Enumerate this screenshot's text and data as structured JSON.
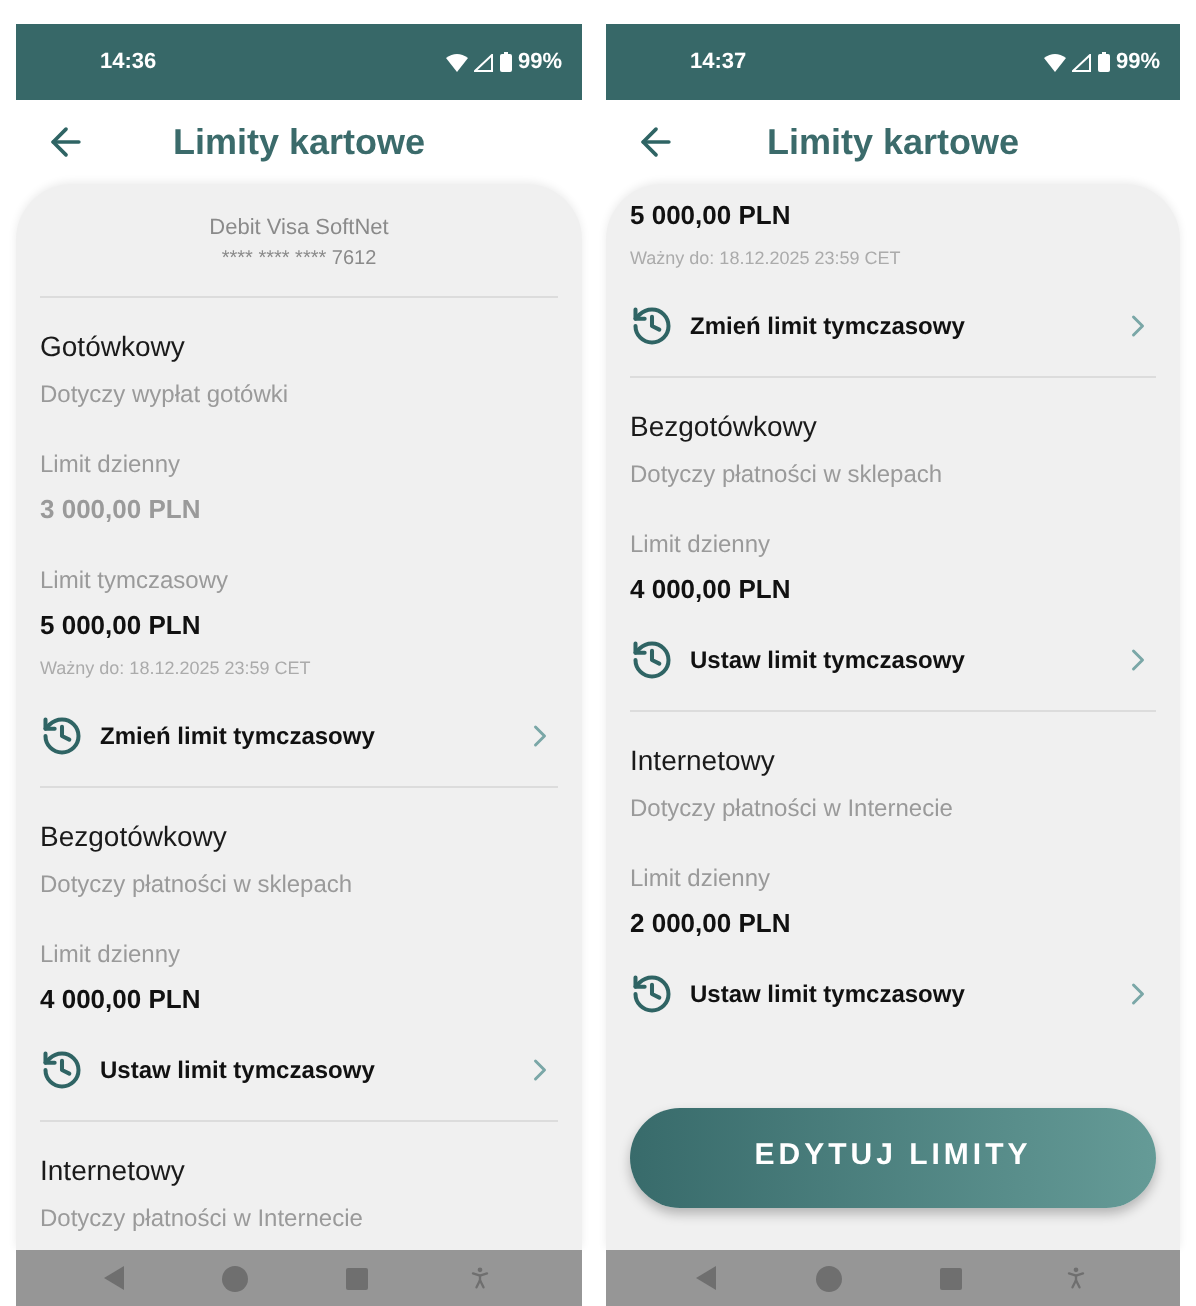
{
  "screens": [
    {
      "status_bar": {
        "time": "14:36",
        "battery": "99%"
      },
      "title": "Limity kartowe",
      "card_header": {
        "name": "Debit Visa SoftNet",
        "number": "**** **** **** 7612"
      },
      "groups": [
        {
          "rows": [
            {
              "kind": "title",
              "text": "Gotówkowy"
            },
            {
              "kind": "description",
              "text": "Dotyczy wypłat gotówki"
            },
            {
              "kind": "label",
              "text": "Limit dzienny"
            },
            {
              "kind": "amount",
              "text": "3 000,00 PLN",
              "disabled": true
            },
            {
              "kind": "label",
              "text": "Limit tymczasowy"
            },
            {
              "kind": "amount",
              "text": "5 000,00 PLN",
              "disabled": false
            },
            {
              "kind": "note",
              "text": "Ważny do: 18.12.2025 23:59 CET"
            },
            {
              "kind": "action",
              "text": "Zmień limit tymczasowy"
            }
          ]
        },
        {
          "rows": [
            {
              "kind": "title",
              "text": "Bezgotówkowy"
            },
            {
              "kind": "description",
              "text": "Dotyczy płatności w sklepach"
            },
            {
              "kind": "label",
              "text": "Limit dzienny"
            },
            {
              "kind": "amount",
              "text": "4 000,00 PLN",
              "disabled": false
            },
            {
              "kind": "action",
              "text": "Ustaw limit tymczasowy"
            }
          ]
        },
        {
          "rows": [
            {
              "kind": "title",
              "text": "Internetowy"
            },
            {
              "kind": "description",
              "text": "Dotyczy płatności w Internecie"
            }
          ]
        }
      ]
    },
    {
      "status_bar": {
        "time": "14:37",
        "battery": "99%"
      },
      "title": "Limity kartowe",
      "groups": [
        {
          "rows": [
            {
              "kind": "amount",
              "text": "5 000,00 PLN",
              "disabled": false
            },
            {
              "kind": "note",
              "text": "Ważny do: 18.12.2025 23:59 CET"
            },
            {
              "kind": "action",
              "text": "Zmień limit tymczasowy"
            }
          ]
        },
        {
          "rows": [
            {
              "kind": "title",
              "text": "Bezgotówkowy"
            },
            {
              "kind": "description",
              "text": "Dotyczy płatności w sklepach"
            },
            {
              "kind": "label",
              "text": "Limit dzienny"
            },
            {
              "kind": "amount",
              "text": "4 000,00 PLN",
              "disabled": false
            },
            {
              "kind": "action",
              "text": "Ustaw limit tymczasowy"
            }
          ]
        },
        {
          "rows": [
            {
              "kind": "title",
              "text": "Internetowy"
            },
            {
              "kind": "description",
              "text": "Dotyczy płatności w Internecie"
            },
            {
              "kind": "label",
              "text": "Limit dzienny"
            },
            {
              "kind": "amount",
              "text": "2 000,00 PLN",
              "disabled": false
            },
            {
              "kind": "action",
              "text": "Ustaw limit tymczasowy"
            }
          ]
        }
      ],
      "button": "EDYTUJ LIMITY"
    }
  ]
}
